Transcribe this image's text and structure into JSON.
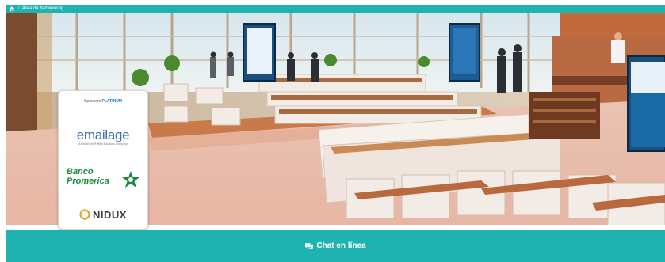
{
  "breadcrumb": {
    "separator": "/",
    "current": "Área de Networking"
  },
  "sponsors": {
    "header_prefix": "Sponsors",
    "header_tier": "PLATINUM",
    "emailage": {
      "name": "emailage",
      "tagline": "A LexisNexis® Risk Solutions Company"
    },
    "banco": {
      "line1": "Banco",
      "line2": "Promerica"
    },
    "nidux": {
      "name": "NIDUX"
    }
  },
  "chat": {
    "label": "Chat en línea",
    "icon": "chat-bubble-icon"
  },
  "colors": {
    "accent": "#1fb3b0",
    "banco_green": "#1b8a3c",
    "emailage_blue": "#3b6fb6"
  }
}
